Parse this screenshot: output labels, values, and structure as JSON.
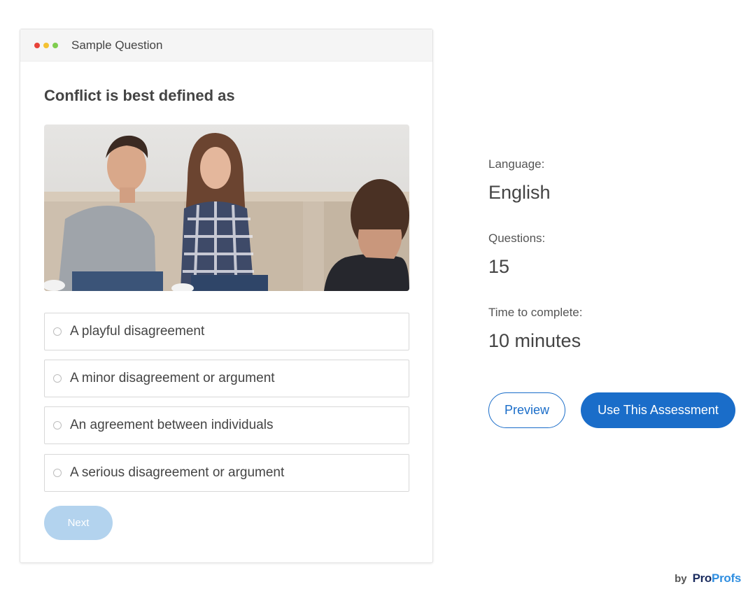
{
  "card": {
    "title": "Sample Question",
    "question": "Conflict is best defined as",
    "image_icon": "photo-counseling-session",
    "options": [
      {
        "label": "A playful disagreement"
      },
      {
        "label": "A minor disagreement or argument"
      },
      {
        "label": "An agreement between individuals"
      },
      {
        "label": "A serious disagreement or argument"
      }
    ],
    "next_label": "Next"
  },
  "info": {
    "language_label": "Language:",
    "language_value": "English",
    "questions_label": "Questions:",
    "questions_value": "15",
    "time_label": "Time to complete:",
    "time_value": "10 minutes"
  },
  "actions": {
    "preview_label": "Preview",
    "use_label": "Use This Assessment"
  },
  "brand": {
    "by": "by",
    "logo_part1": "Pro",
    "logo_part2": "Profs"
  },
  "colors": {
    "accent": "#1a6dc9",
    "next_disabled": "#b3d3ee",
    "dot_red": "#e8433a",
    "dot_yellow": "#f4c233",
    "dot_green": "#7fcd4f"
  }
}
